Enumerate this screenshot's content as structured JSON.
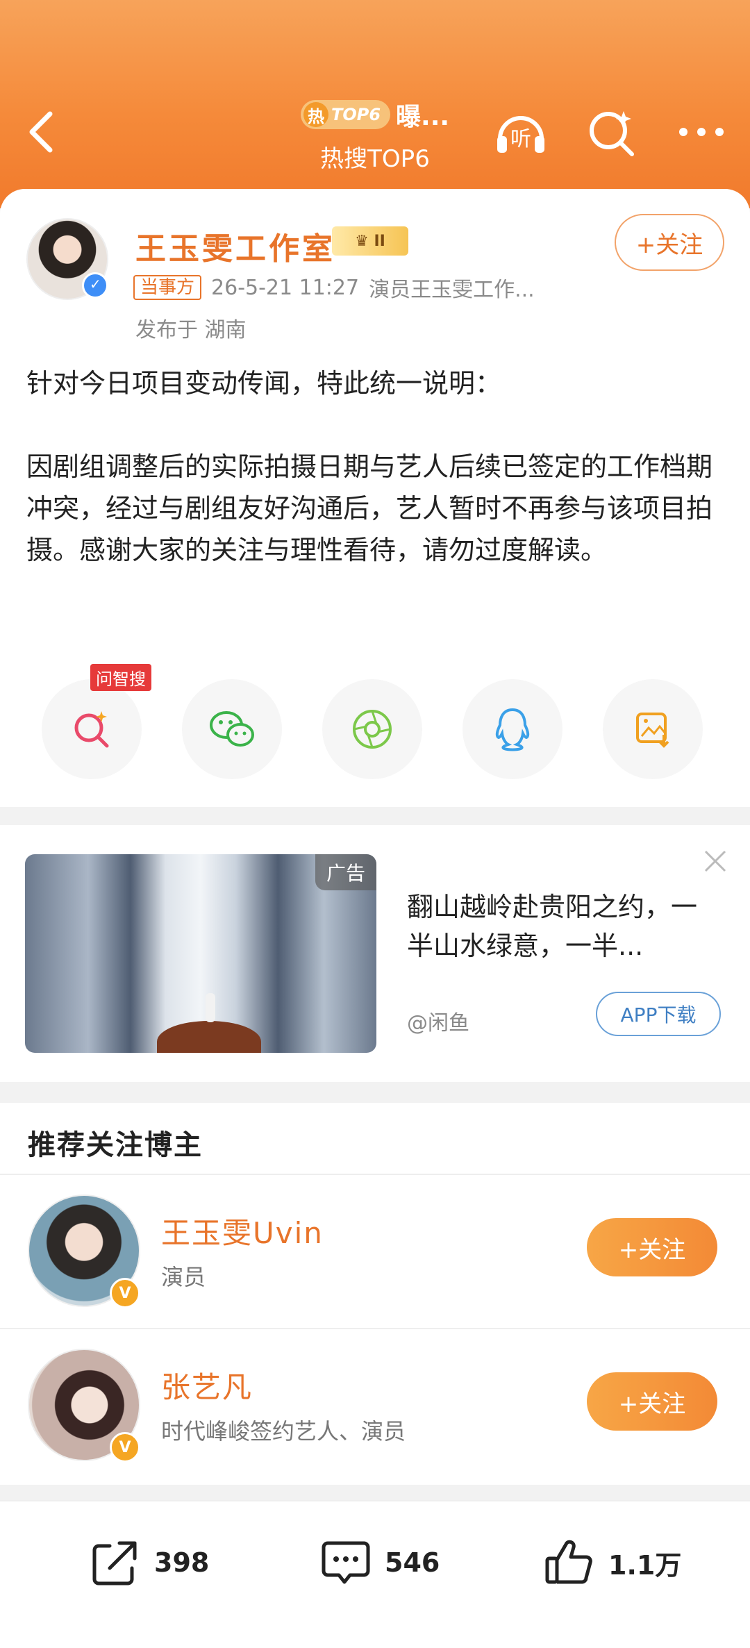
{
  "header": {
    "hot_badge_char": "热",
    "hot_badge_rank": "TOP6",
    "hot_title": "曝...",
    "hot_subtitle": "热搜TOP6",
    "listen_label": "听"
  },
  "post": {
    "author_name": "王玉雯工作室",
    "vip_level": "II",
    "follow_label": "+关注",
    "party_tag": "当事方",
    "time": "26-5-21 11:27",
    "source": "演员王玉雯工作...",
    "location": "发布于 湖南",
    "text_line1": "针对今日项目变动传闻，特此统一说明：",
    "text_para2": "因剧组调整后的实际拍摄日期与艺人后续已签定的工作档期冲突，经过与剧组友好沟通后，艺人暂时不再参与该项目拍摄。感谢大家的关注与理性看待，请勿过度解读。"
  },
  "share": {
    "ai_tag": "问智搜",
    "items": [
      "search-ai-icon",
      "wechat-icon",
      "moments-icon",
      "qq-icon",
      "save-image-icon"
    ]
  },
  "ad": {
    "tag": "广告",
    "text": "翻山越岭赴贵阳之约，一半山水绿意，一半...",
    "source": "@闲鱼",
    "download_label": "APP下载"
  },
  "recommend": {
    "title": "推荐关注博主",
    "follow_label": "+关注",
    "items": [
      {
        "name": "王玉雯Uvin",
        "desc": "演员",
        "badge": "V"
      },
      {
        "name": "张艺凡",
        "desc": "时代峰峻签约艺人、演员",
        "badge": "V"
      }
    ]
  },
  "bottom": {
    "repost_count": "398",
    "comment_count": "546",
    "like_count": "1.1万"
  },
  "colors": {
    "header_orange": "#f58a3a",
    "accent_orange": "#e8742a",
    "link_blue": "#3f7fc3"
  }
}
